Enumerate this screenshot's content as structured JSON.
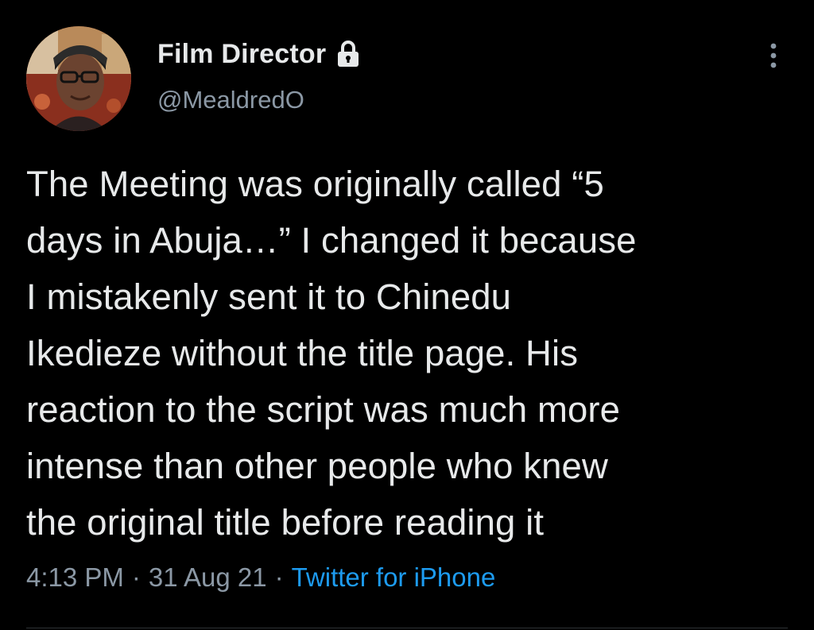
{
  "author": {
    "display_name": "Film Director",
    "handle": "@MealdredO",
    "protected_icon": "lock-icon",
    "avatar_icon": "profile-photo"
  },
  "tweet": {
    "text": "The Meeting was originally called “5\ndays in Abuja…” I changed it because\nI mistakenly sent it to Chinedu\nIkedieze without the title page. His\nreaction to the script was much more\nintense than other people who knew\nthe original title before reading it",
    "time": "4:13 PM",
    "date": "31 Aug 21",
    "source": "Twitter for iPhone",
    "separator": "·"
  },
  "menu": {
    "more_icon": "more-vertical-icon"
  },
  "colors": {
    "background": "#000000",
    "text": "#e7e9ea",
    "secondary": "#8b98a5",
    "link": "#1d9bf0"
  }
}
